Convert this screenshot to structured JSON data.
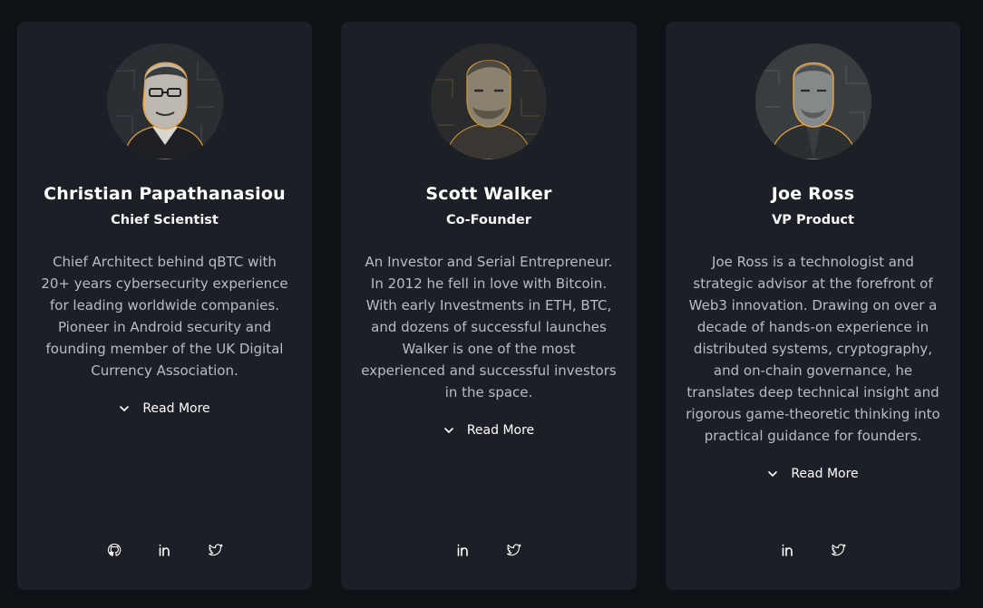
{
  "colors": {
    "page_background": "#0e1116",
    "card_background": "#1c1f26",
    "accent_orange": "#e8a23a",
    "text_primary": "#ffffff",
    "text_secondary": "#b8bcc4"
  },
  "team": [
    {
      "name": "Christian Papathanasiou",
      "role": "Chief Scientist",
      "bio": "Chief Architect behind qBTC with 20+ years cybersecurity experience for leading worldwide companies. Pioneer in Android security and founding member of the UK Digital Currency Association.",
      "read_more": "Read More",
      "socials": [
        "github-icon",
        "linkedin-icon",
        "twitter-icon"
      ]
    },
    {
      "name": "Scott Walker",
      "role": "Co-Founder",
      "bio": "An Investor and Serial Entrepreneur. In 2012 he fell in love with Bitcoin. With early Investments in ETH, BTC, and dozens of successful launches Walker is one of the most experienced and successful investors in the space.",
      "read_more": "Read More",
      "socials": [
        "linkedin-icon",
        "twitter-icon"
      ]
    },
    {
      "name": "Joe Ross",
      "role": "VP Product",
      "bio": "Joe Ross is a technologist and strategic advisor at the forefront of Web3 innovation. Drawing on over a decade of hands-on experience in distributed systems, cryptography, and on-chain governance, he translates deep technical insight and rigorous game-theoretic thinking into practical guidance for founders.",
      "read_more": "Read More",
      "socials": [
        "linkedin-icon",
        "twitter-icon"
      ]
    }
  ]
}
